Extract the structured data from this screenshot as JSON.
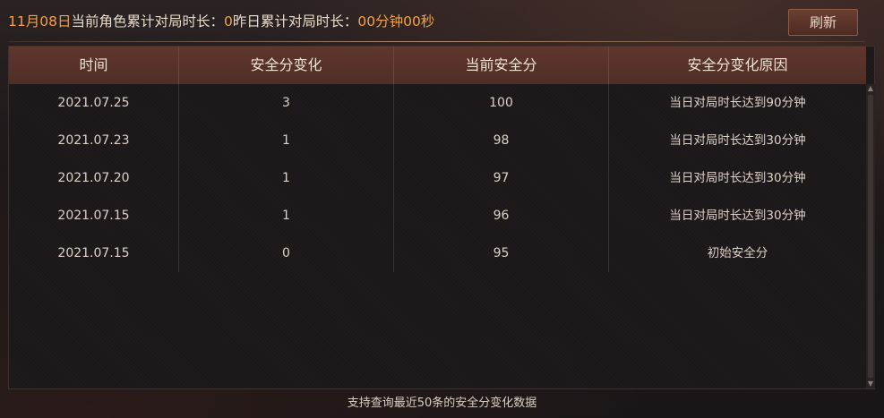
{
  "header": {
    "date": "11月08日",
    "label_current": "当前角色累计对局时长：",
    "current_value": "0",
    "label_yesterday": "昨日累计对局时长：",
    "yesterday_value": "00分钟00秒",
    "refresh_label": "刷新"
  },
  "table": {
    "columns": [
      "时间",
      "安全分变化",
      "当前安全分",
      "安全分变化原因"
    ],
    "rows": [
      [
        "2021.07.25",
        "3",
        "100",
        "当日对局时长达到90分钟"
      ],
      [
        "2021.07.23",
        "1",
        "98",
        "当日对局时长达到30分钟"
      ],
      [
        "2021.07.20",
        "1",
        "97",
        "当日对局时长达到30分钟"
      ],
      [
        "2021.07.15",
        "1",
        "96",
        "当日对局时长达到30分钟"
      ],
      [
        "2021.07.15",
        "0",
        "95",
        "初始安全分"
      ]
    ]
  },
  "footer": {
    "note": "支持查询最近50条的安全分变化数据"
  },
  "icons": {
    "scroll_up": "triangle-up",
    "scroll_down": "triangle-down"
  },
  "colors": {
    "highlight": "#f3a146",
    "header_bg": "#5e372d",
    "button_bg": "#5a3429"
  }
}
